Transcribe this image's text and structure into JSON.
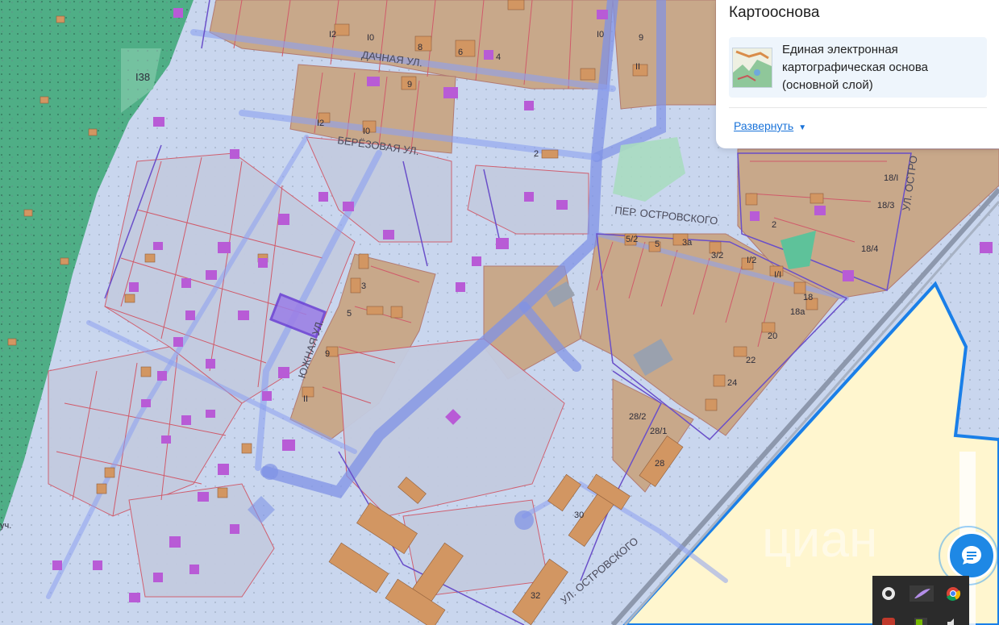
{
  "panel": {
    "title": "Картооснова",
    "layer_label": "Единая электронная картографическая основа (основной слой)",
    "expand_label": "Развернуть"
  },
  "map": {
    "streets": {
      "dachnaya": "ДАЧНАЯ УЛ.",
      "beryozovaya": "БЕРЁЗОВАЯ УЛ.",
      "yuzhnaya": "ЮЖНАЯ УЛ.",
      "per_ostrovskogo": "ПЕР. ОСТРОВСКОГО",
      "ul_ostrovskogo": "УЛ. ОСТРОВСКОГО",
      "ul_ostro_top": "УЛ. ОСТРО"
    },
    "numbers": {
      "n138": "I38",
      "n12a": "I2",
      "n10a": "I0",
      "n8": "8",
      "n6": "6",
      "n4": "4",
      "n10b": "I0",
      "n9a": "9",
      "n11a": "II",
      "n12b": "I2",
      "n10c": "I0",
      "n9b": "9",
      "n2a": "2",
      "n3": "3",
      "n5": "5",
      "n9c": "9",
      "n11b": "II",
      "n52": "5/2",
      "n5b": "5",
      "n3a": "3а",
      "n32": "3/2",
      "n12c": "I/2",
      "n11c": "I/I",
      "n18": "18",
      "n18a": "18а",
      "n20": "20",
      "n22": "22",
      "n24": "24",
      "n282": "28/2",
      "n281": "28/1",
      "n28": "28",
      "n30": "30",
      "n32b": "32",
      "n2b": "2",
      "n183": "18/3",
      "n184": "18/4",
      "n181": "18/I",
      "n_uch": "уч."
    },
    "watermark": "циан"
  },
  "chat_button": {
    "icon": "chat-icon"
  },
  "tray": {
    "icons": [
      "obs-icon",
      "feather-icon",
      "chrome-icon",
      "app-icon",
      "nvidia-icon",
      "speaker-icon"
    ]
  },
  "colors": {
    "forest": "#4fae86",
    "parcel_fill": "#c3cbe0",
    "built_zone": "#c8a88a",
    "building": "#d29662",
    "structure": "#b85bd6",
    "road": "#7f92e6",
    "boundary": "#1a7fe8",
    "yellow_zone": "#fff6cf",
    "accent": "#1a73d9"
  }
}
